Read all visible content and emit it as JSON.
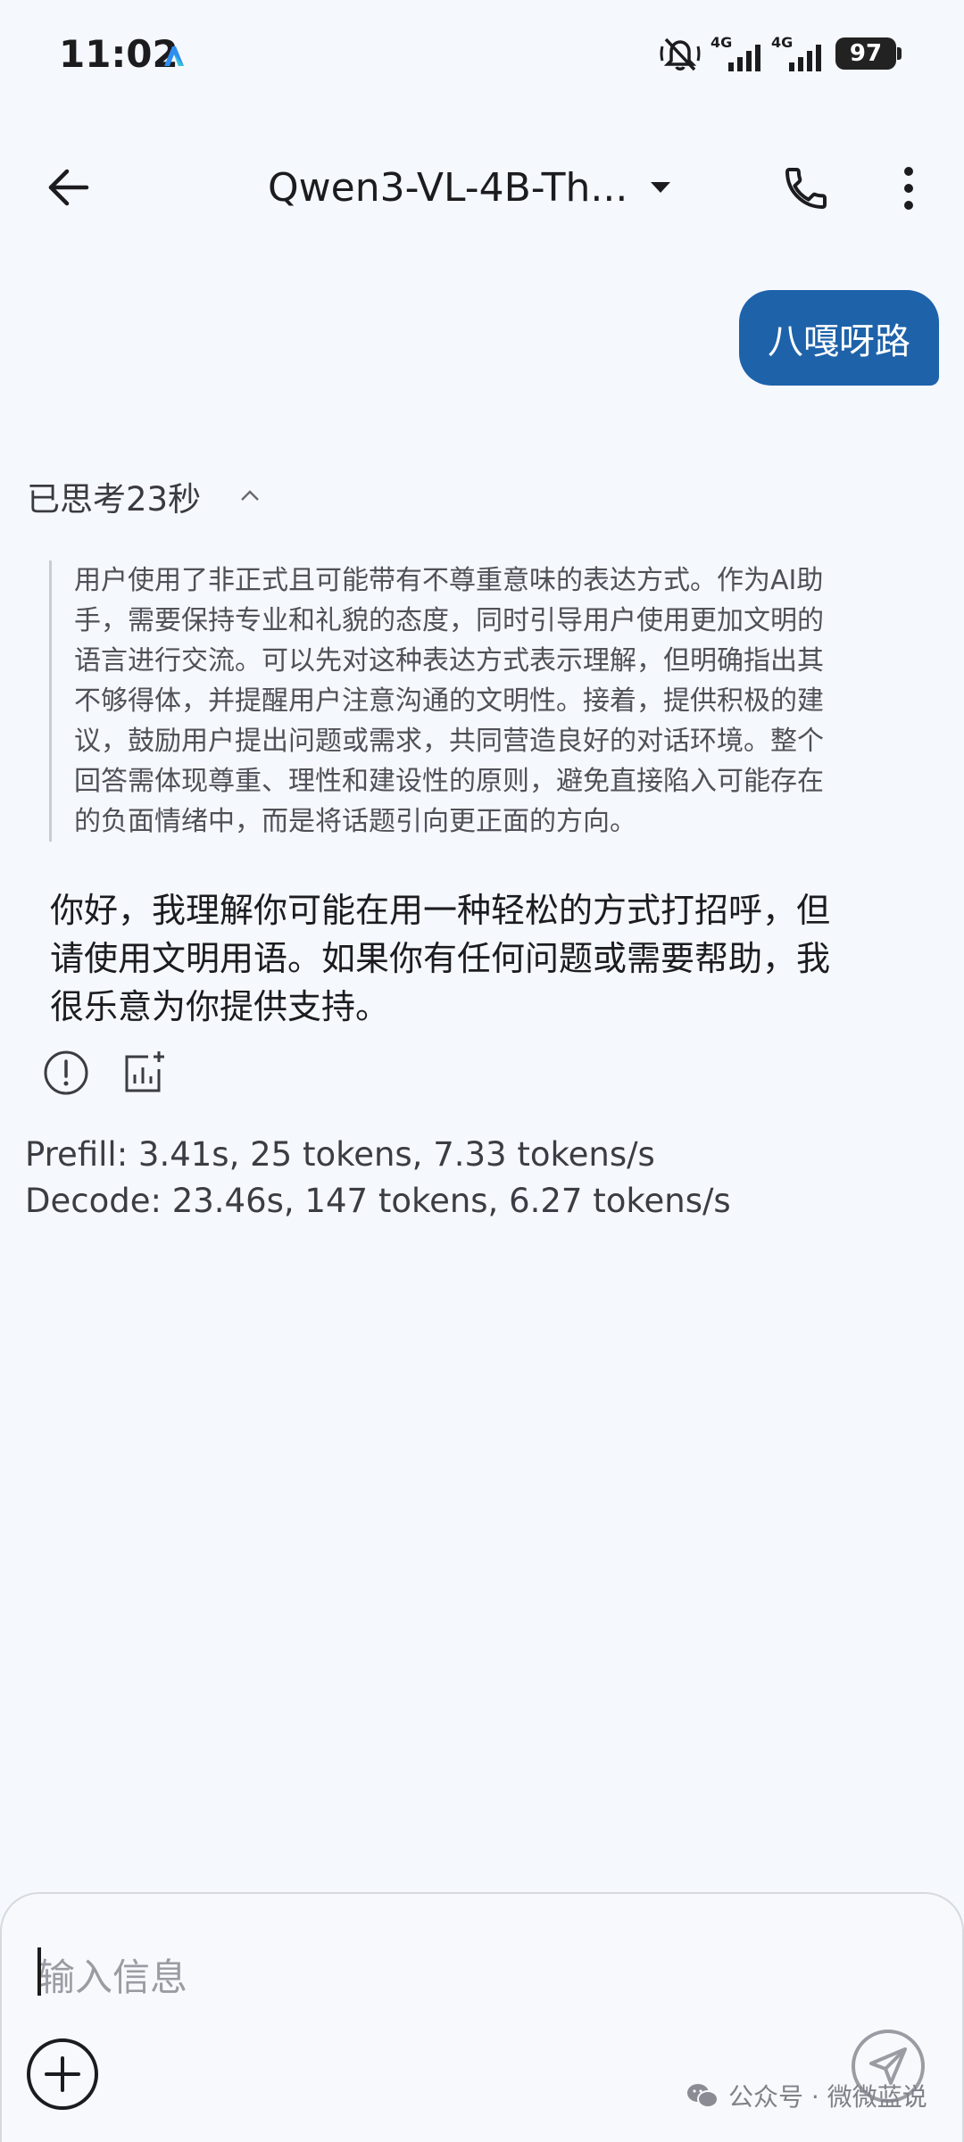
{
  "status_bar": {
    "time": "11:02",
    "network_1": "4G",
    "network_2": "4G",
    "battery": "97",
    "icons": [
      "app-icon",
      "mute-icon",
      "signal-icon",
      "signal-icon",
      "battery-icon"
    ]
  },
  "app_bar": {
    "model_name": "Qwen3-VL-4B-Th...",
    "icons": [
      "back-arrow-icon",
      "chevron-down-icon",
      "phone-icon",
      "more-vert-icon"
    ]
  },
  "messages": {
    "user_message": "八嘎呀路",
    "thinking_label": "已思考23秒",
    "thinking_text": "用户使用了非正式且可能带有不尊重意味的表达方式。作为AI助手，需要保持专业和礼貌的态度，同时引导用户使用更加文明的语言进行交流。可以先对这种表达方式表示理解，但明确指出其不够得体，并提醒用户注意沟通的文明性。接着，提供积极的建议，鼓励用户提出问题或需求，共同营造良好的对话环境。整个回答需体现尊重、理性和建设性的原则，避免直接陷入可能存在的负面情绪中，而是将话题引向更正面的方向。",
    "assistant_reply": "你好，我理解你可能在用一种轻松的方式打招呼，但请使用文明用语。如果你有任何问题或需要帮助，我很乐意为你提供支持。",
    "action_icons": [
      "report-icon",
      "stats-icon"
    ]
  },
  "stats": {
    "prefill": "Prefill: 3.41s, 25 tokens, 7.33 tokens/s",
    "decode": "Decode: 23.46s, 147 tokens, 6.27 tokens/s"
  },
  "input": {
    "placeholder": "输入信息",
    "value": "",
    "icons": [
      "add-circle-icon",
      "send-icon"
    ]
  },
  "watermark": {
    "text": "公众号 · 微微蓝说"
  },
  "colors": {
    "background": "#f5f8fd",
    "user_bubble": "#1e62aa",
    "text": "#1c1c1f"
  }
}
